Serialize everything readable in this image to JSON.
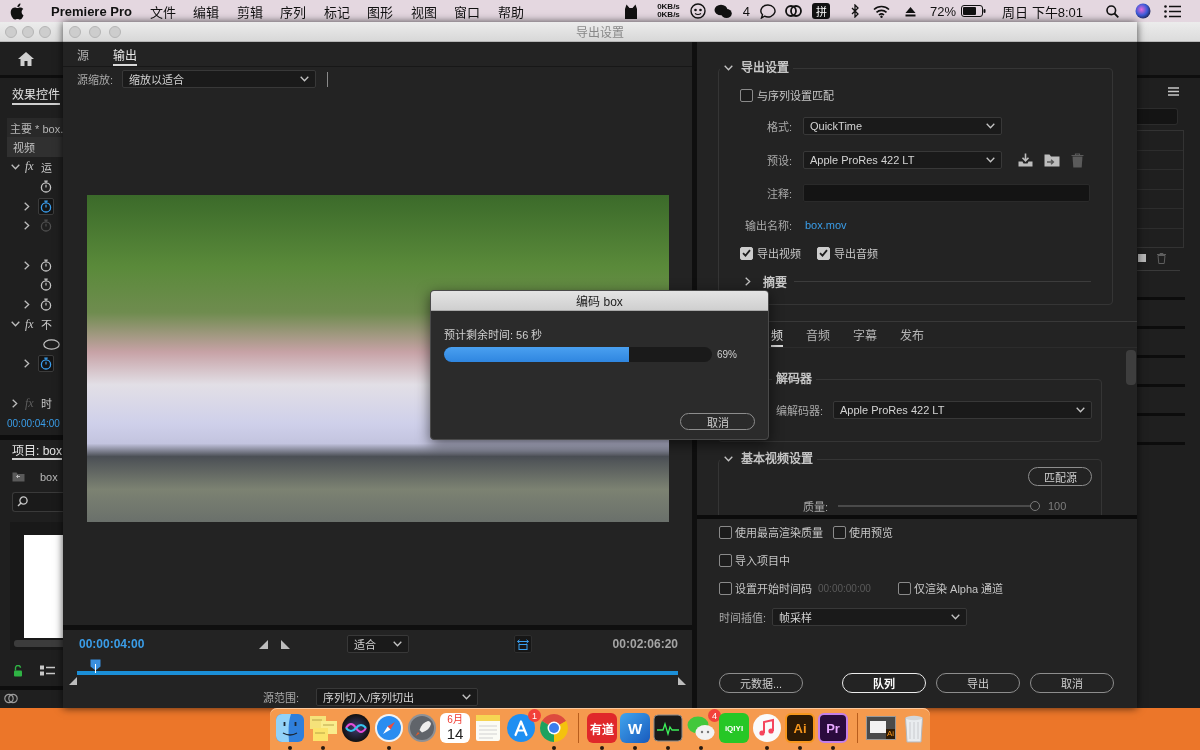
{
  "menubar": {
    "app_name": "Premiere Pro",
    "menus": [
      "文件",
      "编辑",
      "剪辑",
      "序列",
      "标记",
      "图形",
      "视图",
      "窗口",
      "帮助"
    ],
    "net_speed": [
      "0KB/s",
      "0KB/s"
    ],
    "chat_count": "4",
    "input_method": "拼",
    "battery": "72%",
    "clock": "周日 下午8:01"
  },
  "main_window": {
    "effect_controls": {
      "tab": {
        "label": "效果控件",
        "selected": true
      },
      "clip": "主要 * box.",
      "group": "视频",
      "rows": [
        {
          "kind": "effect",
          "toggle": "fx",
          "label": "运",
          "expanded": true,
          "enabled": true
        },
        {
          "kind": "property",
          "expandable": false,
          "animated": false,
          "enabled": true
        },
        {
          "kind": "property",
          "expandable": true,
          "animated": true,
          "enabled": true
        },
        {
          "kind": "property",
          "expandable": true,
          "animated": false,
          "enabled": false
        },
        {
          "kind": "blank"
        },
        {
          "kind": "property",
          "expandable": true,
          "animated": false,
          "enabled": true
        },
        {
          "kind": "property",
          "expandable": false,
          "animated": false,
          "enabled": true
        },
        {
          "kind": "property",
          "expandable": true,
          "animated": false,
          "enabled": true
        },
        {
          "kind": "effect",
          "toggle": "fx",
          "label": "不",
          "expanded": true,
          "enabled": true
        },
        {
          "kind": "mask"
        },
        {
          "kind": "property",
          "expandable": true,
          "animated": true,
          "enabled": true
        },
        {
          "kind": "blank"
        },
        {
          "kind": "effect",
          "toggle": "fx",
          "label": "时",
          "expanded": false,
          "enabled": false
        }
      ],
      "timecode": "00:00:04:00"
    },
    "project": {
      "tab": {
        "label": "项目: box",
        "selected": true
      },
      "bin": "box"
    }
  },
  "export_window": {
    "title": "导出设置",
    "source_tabs": [
      {
        "label": "源",
        "selected": false
      },
      {
        "label": "输出",
        "selected": true
      }
    ],
    "source_scaling": {
      "label": "源缩放:",
      "value": "缩放以适合"
    },
    "playback": {
      "current_time": "00:00:04:00",
      "fit": "适合",
      "duration": "00:02:06:20",
      "level": 0.03
    },
    "source_range": {
      "label": "源范围:",
      "value": "序列切入/序列切出"
    },
    "export_settings": {
      "title": "导出设置",
      "expanded": true,
      "match_sequence": {
        "label": "与序列设置匹配",
        "checked": false
      },
      "fields": [
        {
          "kind": "dropdown",
          "label": "格式:",
          "value": "QuickTime"
        },
        {
          "kind": "preset",
          "label": "预设:",
          "value": "Apple ProRes 422 LT"
        },
        {
          "kind": "input",
          "label": "注释:"
        },
        {
          "kind": "link",
          "label": "输出名称:",
          "value": "box.mov"
        }
      ],
      "exports": [
        {
          "label": "导出视频",
          "checked": true
        },
        {
          "label": "导出音频",
          "checked": true
        }
      ],
      "summary": {
        "title": "摘要",
        "expanded": false
      }
    },
    "tabs": [
      {
        "label": "频",
        "selected": true
      },
      {
        "label": "音频",
        "selected": false
      },
      {
        "label": "字幕",
        "selected": false
      },
      {
        "label": "发布",
        "selected": false
      }
    ],
    "codec": {
      "title": "解码器",
      "label": "编解码器:",
      "value": "Apple ProRes 422 LT"
    },
    "basic_video": {
      "title": "基本视频设置",
      "expanded": true,
      "button": "匹配源",
      "quality_label": "质量:",
      "level": 1,
      "quality_value": "100"
    },
    "option_rows": [
      {
        "options": [
          {
            "label": "使用最高渲染质量",
            "checked": false
          },
          {
            "label": "使用预览",
            "checked": false
          }
        ]
      },
      {
        "options": [
          {
            "label": "导入项目中",
            "checked": false
          }
        ]
      },
      {
        "options": [
          {
            "label": "设置开始时间码",
            "checked": false,
            "timecode": "00:00:00:00"
          },
          {
            "label": "仅渲染 Alpha 通道",
            "checked": false
          }
        ]
      }
    ],
    "time_interpolation": {
      "label": "时间插值:",
      "value": "帧采样"
    },
    "buttons": [
      {
        "label": "元数据...",
        "default": false
      },
      {
        "label": "队列",
        "default": true
      },
      {
        "label": "导出",
        "default": false
      },
      {
        "label": "取消",
        "default": false
      }
    ]
  },
  "encode_dialog": {
    "title": "编码 box",
    "remaining": "预计剩余时间: 56 秒",
    "level": 0.69,
    "percent": "69%",
    "button": "取消"
  },
  "dock": {
    "items": [
      {
        "kind": "finder",
        "running": true
      },
      {
        "kind": "stickies",
        "running": true
      },
      {
        "kind": "siri",
        "running": false
      },
      {
        "kind": "safari",
        "running": true
      },
      {
        "kind": "launchpad",
        "running": false
      },
      {
        "kind": "calendar",
        "month": "6月",
        "day": "14",
        "running": false
      },
      {
        "kind": "notes",
        "running": false
      },
      {
        "kind": "app_store",
        "badge": "1",
        "running": false
      },
      {
        "kind": "chrome",
        "running": true
      },
      {
        "kind": "separator"
      },
      {
        "kind": "youdao",
        "label": "有道",
        "running": true
      },
      {
        "kind": "word",
        "label": "W",
        "running": true
      },
      {
        "kind": "activity_monitor",
        "running": true
      },
      {
        "kind": "wechat",
        "badge": "4",
        "running": true
      },
      {
        "kind": "iqiyi",
        "label": "iQIYI",
        "running": false
      },
      {
        "kind": "music",
        "running": true
      },
      {
        "kind": "illustrator",
        "label": "Ai",
        "running": true
      },
      {
        "kind": "premiere",
        "label": "Pr",
        "running": true
      },
      {
        "kind": "separator"
      },
      {
        "kind": "minimized_window",
        "label": "Ai",
        "running": false
      },
      {
        "kind": "trash",
        "running": false
      }
    ]
  }
}
